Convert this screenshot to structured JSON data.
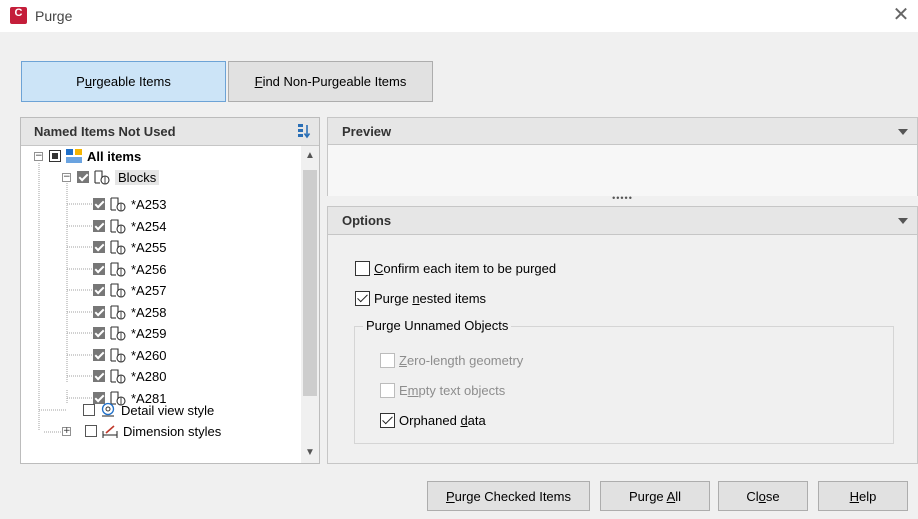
{
  "window": {
    "title": "Purge",
    "app_icon_letter": "C"
  },
  "tabs": [
    {
      "label_pre": "P",
      "label_u": "u",
      "label_post": "rgeable Items",
      "active": true
    },
    {
      "label_pre": "",
      "label_u": "F",
      "label_post": "ind Non-Purgeable Items",
      "active": false
    }
  ],
  "left_panel": {
    "header": "Named Items Not Used",
    "tree": [
      {
        "label": "All items",
        "level": 0,
        "bold": true
      },
      {
        "label": "Blocks",
        "level": 1
      },
      {
        "label": "*A253",
        "level": 2
      },
      {
        "label": "*A254",
        "level": 2
      },
      {
        "label": "*A255",
        "level": 2
      },
      {
        "label": "*A256",
        "level": 2
      },
      {
        "label": "*A257",
        "level": 2
      },
      {
        "label": "*A258",
        "level": 2
      },
      {
        "label": "*A259",
        "level": 2
      },
      {
        "label": "*A260",
        "level": 2
      },
      {
        "label": "*A280",
        "level": 2
      },
      {
        "label": "*A281",
        "level": 2
      },
      {
        "label": "Detail view style",
        "level": 1
      },
      {
        "label": "Dimension styles",
        "level": 1
      }
    ]
  },
  "preview": {
    "title": "Preview"
  },
  "options": {
    "title": "Options",
    "confirm": {
      "pre": "",
      "u": "C",
      "post": "onfirm each item to be purged",
      "checked": false
    },
    "nested": {
      "pre": "Purge ",
      "u": "n",
      "post": "ested items",
      "checked": true
    },
    "group_label": "Purge Unnamed Objects",
    "zero_length": {
      "pre": "",
      "u": "Z",
      "post": "ero-length geometry",
      "checked": false,
      "disabled": true
    },
    "empty_text": {
      "pre": "E",
      "u": "m",
      "post": "pty text objects",
      "checked": false,
      "disabled": true
    },
    "orphaned": {
      "pre": "Orphaned ",
      "u": "d",
      "post": "ata",
      "checked": true
    }
  },
  "buttons": {
    "purge_checked": {
      "pre": "",
      "u": "P",
      "post": "urge Checked Items"
    },
    "purge_all": {
      "pre": "Purge ",
      "u": "A",
      "post": "ll"
    },
    "close": {
      "pre": "Cl",
      "u": "o",
      "post": "se"
    },
    "help": {
      "pre": "",
      "u": "H",
      "post": "elp"
    }
  },
  "colors": {
    "active_tab": "#cce4f7",
    "app_icon": "#c41e3a"
  }
}
